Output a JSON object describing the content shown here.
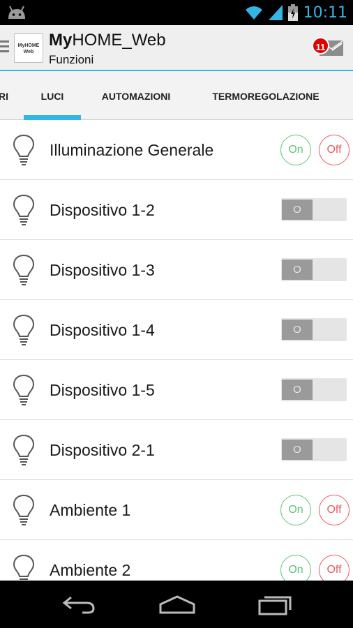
{
  "status_bar": {
    "time": "10:11",
    "icons": [
      "android-icon",
      "wifi-icon",
      "signal-icon",
      "battery-charging-icon"
    ]
  },
  "action_bar": {
    "logo_text": "MyHOME Web",
    "title_bold": "My",
    "title_rest": "HOME_Web",
    "subtitle": "Funzioni",
    "notification_count": "11"
  },
  "tabs": {
    "cut_label": "RI",
    "items": [
      {
        "label": "LUCI",
        "selected": true
      },
      {
        "label": "AUTOMAZIONI",
        "selected": false
      },
      {
        "label": "TERMOREGOLAZIONE",
        "selected": false
      }
    ]
  },
  "list": {
    "rows": [
      {
        "label": "Illuminazione Generale",
        "control": "on-off",
        "on": "On",
        "off": "Off"
      },
      {
        "label": "Dispositivo 1-2",
        "control": "toggle",
        "toggle": "O"
      },
      {
        "label": "Dispositivo 1-3",
        "control": "toggle",
        "toggle": "O"
      },
      {
        "label": "Dispositivo 1-4",
        "control": "toggle",
        "toggle": "O"
      },
      {
        "label": "Dispositivo 1-5",
        "control": "toggle",
        "toggle": "O"
      },
      {
        "label": "Dispositivo 2-1",
        "control": "toggle",
        "toggle": "O"
      },
      {
        "label": "Ambiente 1",
        "control": "on-off",
        "on": "On",
        "off": "Off"
      },
      {
        "label": "Ambiente 2",
        "control": "on-off",
        "on": "On",
        "off": "Off"
      }
    ]
  },
  "nav_bar": {
    "icons": [
      "back-icon",
      "home-icon",
      "recent-apps-icon"
    ]
  },
  "colors": {
    "accent": "#33b5e5",
    "on": "#5ec47a",
    "off": "#ec5b62",
    "badge": "#e10000"
  }
}
